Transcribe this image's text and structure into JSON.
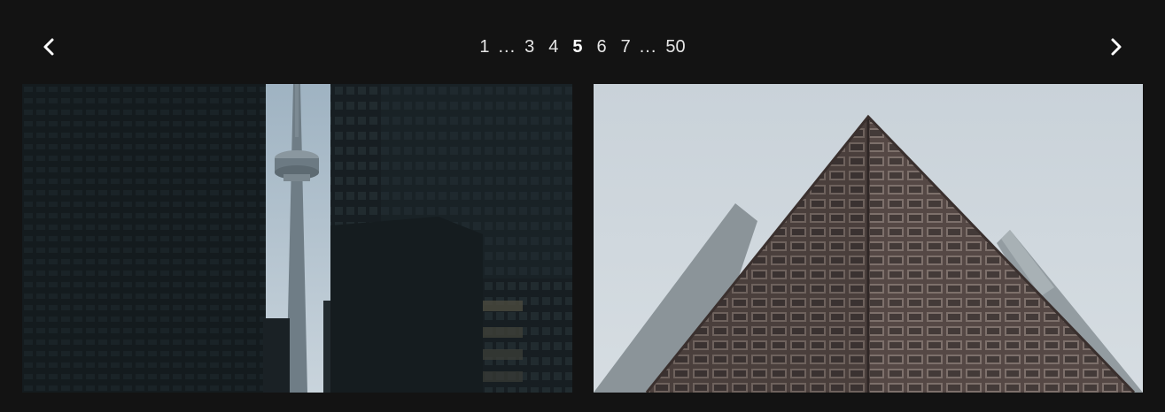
{
  "navigation": {
    "prev_icon": "chevron-left-icon",
    "next_icon": "chevron-right-icon"
  },
  "pagination": {
    "items": [
      {
        "label": "1",
        "type": "page",
        "active": false
      },
      {
        "label": "...",
        "type": "ellipsis",
        "active": false
      },
      {
        "label": "3",
        "type": "page",
        "active": false
      },
      {
        "label": "4",
        "type": "page",
        "active": false
      },
      {
        "label": "5",
        "type": "page",
        "active": true
      },
      {
        "label": "6",
        "type": "page",
        "active": false
      },
      {
        "label": "7",
        "type": "page",
        "active": false
      },
      {
        "label": "...",
        "type": "ellipsis",
        "active": false
      },
      {
        "label": "50",
        "type": "page",
        "active": false
      }
    ],
    "current": 5,
    "total": 50
  },
  "colors": {
    "background": "#131313",
    "text": "#e6e6e6",
    "active_text": "#ffffff"
  }
}
